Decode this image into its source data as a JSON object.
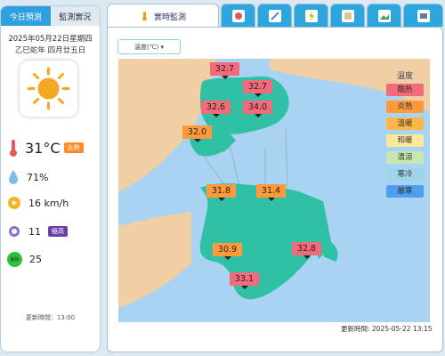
{
  "left": {
    "tabs": [
      {
        "label": "今日預測"
      },
      {
        "label": "監測實況"
      }
    ],
    "date_line1": "2025年05月22日星期四",
    "date_line2": "乙巳蛇年 四月廿五日",
    "weather_icon": "sun-icon",
    "temperature": "31°C",
    "temp_badge": "炎熱",
    "humidity": "71%",
    "wind": "16 km/h",
    "uv": "11",
    "uv_badge": "極高",
    "aqi_icon_label": "良好",
    "aqi": "25",
    "update": "更新時間：13:00"
  },
  "right": {
    "tabs": [
      {
        "label": "實時監測",
        "icon": "thermometer-icon"
      },
      {
        "icon": "radar-icon"
      },
      {
        "icon": "satellite-icon"
      },
      {
        "icon": "lightning-icon"
      },
      {
        "icon": "chart-icon"
      },
      {
        "icon": "camera-icon"
      },
      {
        "icon": "webcam-icon"
      }
    ],
    "dropdown": "溫度(℃) ▾",
    "legend_title": "溫度",
    "legend": [
      {
        "label": "酷熱",
        "color": "#f36b79"
      },
      {
        "label": "炎熱",
        "color": "#ff9a3a"
      },
      {
        "label": "溫暖",
        "color": "#ffb648"
      },
      {
        "label": "和暖",
        "color": "#ffe89a"
      },
      {
        "label": "清涼",
        "color": "#c6e7b0"
      },
      {
        "label": "寒冷",
        "color": "#9fd3e6"
      },
      {
        "label": "嚴寒",
        "color": "#4f9ff0"
      }
    ],
    "stations": [
      {
        "value": "32.7",
        "cls": "hot"
      },
      {
        "value": "32.7",
        "cls": "hot"
      },
      {
        "value": "32.6",
        "cls": "hot"
      },
      {
        "value": "34.0",
        "cls": "hot"
      },
      {
        "value": "32.0",
        "cls": "warm"
      },
      {
        "value": "31.8",
        "cls": "warm"
      },
      {
        "value": "31.4",
        "cls": "warm"
      },
      {
        "value": "30.9",
        "cls": "warm"
      },
      {
        "value": "32.8",
        "cls": "hot"
      },
      {
        "value": "33.1",
        "cls": "hot"
      }
    ],
    "update": "更新時間: 2025-05-22 13:15"
  }
}
